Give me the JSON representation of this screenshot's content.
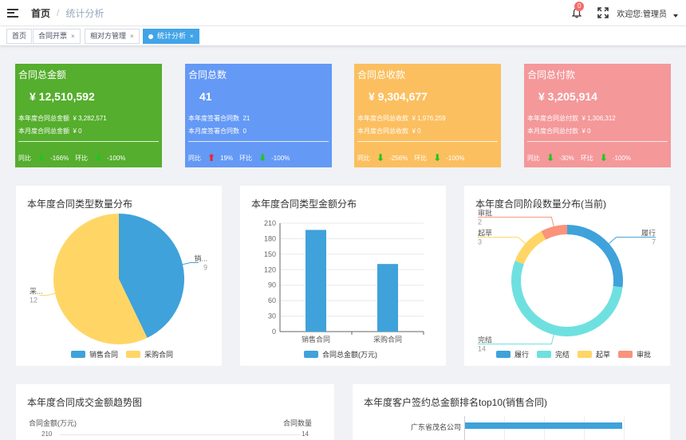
{
  "navbar": {
    "breadcrumb_home": "首页",
    "breadcrumb_separator": "/",
    "breadcrumb_current": "统计分析",
    "notification_count": "0",
    "welcome_text": "欢迎您:管理员"
  },
  "tags": [
    {
      "label": "首页",
      "closable": false,
      "active": false
    },
    {
      "label": "合同开票",
      "closable": true,
      "active": false
    },
    {
      "label": "相对方管理",
      "closable": true,
      "active": false
    },
    {
      "label": "统计分析",
      "closable": true,
      "active": true
    }
  ],
  "tag_close_glyph": "×",
  "cards": [
    {
      "title": "合同总金额",
      "amount": "¥ 12,510,592",
      "row1_label": "本年度合同总金额",
      "row1_value": "¥ 3,282,571",
      "row2_label": "本月度合同总金额",
      "row2_value": "¥ 0",
      "yoy_label": "同比",
      "yoy_arrow": "down",
      "yoy_value": "-166%",
      "mom_label": "环比",
      "mom_arrow": "down",
      "mom_value": "-100%",
      "color": "#55ae2d"
    },
    {
      "title": "合同总数",
      "amount": "41",
      "row1_label": "本年度签署合同数",
      "row1_value": "21",
      "row2_label": "本月度签署合同数",
      "row2_value": "0",
      "yoy_label": "同比",
      "yoy_arrow": "up",
      "yoy_value": "19%",
      "mom_label": "环比",
      "mom_arrow": "down",
      "mom_value": "-100%",
      "color": "#6499f5"
    },
    {
      "title": "合同总收款",
      "amount": "¥ 9,304,677",
      "row1_label": "本年度合同总收款",
      "row1_value": "¥ 1,976,259",
      "row2_label": "本月度合同总收款",
      "row2_value": "¥ 0",
      "yoy_label": "同比",
      "yoy_arrow": "down",
      "yoy_value": "-256%",
      "mom_label": "环比",
      "mom_arrow": "down",
      "mom_value": "-100%",
      "color": "#fbbf5f"
    },
    {
      "title": "合同总付款",
      "amount": "¥ 3,205,914",
      "row1_label": "本年度合同总付款",
      "row1_value": "¥ 1,306,312",
      "row2_label": "本月度合同总付款",
      "row2_value": "¥ 0",
      "yoy_label": "同比",
      "yoy_arrow": "down",
      "yoy_value": "-30%",
      "mom_label": "环比",
      "mom_arrow": "down",
      "mom_value": "-100%",
      "color": "#f4989a"
    }
  ],
  "arrow_glyphs": {
    "down": "⬇",
    "up": "⬆"
  },
  "panels": {
    "pie_title": "本年度合同类型数量分布",
    "bar_title": "本年度合同类型金额分布",
    "donut_title": "本年度合同阶段数量分布(当前)",
    "trend_title": "本年度合同成交金额趋势图",
    "rank_title": "本年度客户签约总金额排名top10(销售合同)"
  },
  "chart_data": [
    {
      "type": "pie",
      "title": "本年度合同类型数量分布",
      "slices": [
        {
          "name": "销售合同",
          "value": 9,
          "color": "#3fa2da",
          "label": "销..."
        },
        {
          "name": "采购合同",
          "value": 12,
          "color": "#ffd666",
          "label": "采..."
        }
      ]
    },
    {
      "type": "bar",
      "title": "本年度合同类型金额分布",
      "categories": [
        "销售合同",
        "采购合同"
      ],
      "series": [
        {
          "name": "合同总金额(万元)",
          "values": [
            197,
            131
          ],
          "color": "#3fa2da"
        }
      ],
      "ylim": [
        0,
        210
      ],
      "yticks": [
        "0",
        "30",
        "60",
        "90",
        "120",
        "150",
        "180",
        "210"
      ]
    },
    {
      "type": "pie",
      "title": "本年度合同阶段数量分布(当前)",
      "slices": [
        {
          "name": "履行",
          "value": 7,
          "color": "#3fa2da"
        },
        {
          "name": "完结",
          "value": 14,
          "color": "#6fe0e0"
        },
        {
          "name": "起草",
          "value": 3,
          "color": "#ffd666"
        },
        {
          "name": "审批",
          "value": 2,
          "color": "#f9937b"
        }
      ]
    },
    {
      "type": "line",
      "title": "本年度合同成交金额趋势图",
      "ylabel": "合同金额(万元)",
      "y2label": "合同数量",
      "ytop_tick": "210",
      "y2top_tick": "14"
    },
    {
      "type": "bar",
      "title": "本年度客户签约总金额排名top10(销售合同)",
      "categories": [
        "广东省茂名公司"
      ]
    }
  ]
}
